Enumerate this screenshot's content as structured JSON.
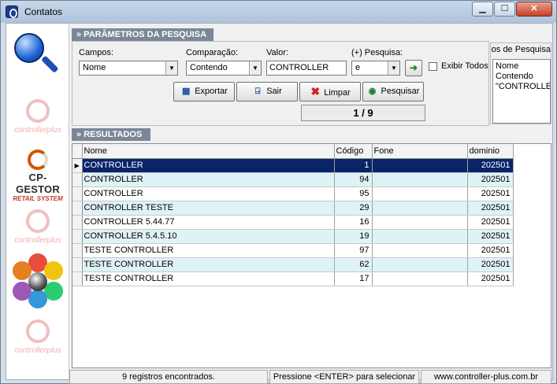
{
  "window": {
    "title": "Contatos",
    "controls": [
      "minimize",
      "maximize",
      "close"
    ]
  },
  "sidebar": {
    "logos": [
      {
        "name": "search-logo",
        "text": ""
      },
      {
        "name": "controllerplus-logo-1",
        "text": "controllerplus"
      },
      {
        "name": "cp-gestor-logo",
        "line1": "CP-GESTOR",
        "line2": "RETAIL SYSTEM"
      },
      {
        "name": "controllerplus-logo-2",
        "text": "controllerplus"
      },
      {
        "name": "flower-logo",
        "text": ""
      },
      {
        "name": "controllerplus-logo-3",
        "text": "controllerplus"
      }
    ]
  },
  "params": {
    "header": "» PARÂMETROS DA PESQUISA",
    "campos_label": "Campos:",
    "campos_value": "Nome",
    "comparacao_label": "Comparação:",
    "comparacao_value": "Contendo",
    "valor_label": "Valor:",
    "valor_value": "CONTROLLER",
    "pesquisa_label": "(+) Pesquisa:",
    "pesquisa_value": "e",
    "exibir_todos_label": "Exibir Todos",
    "exibir_todos_checked": false,
    "buttons": {
      "exportar": "Exportar",
      "sair": "Sair",
      "limpar": "Limpar",
      "pesquisar": "Pesquisar"
    },
    "page_counter": "1 / 9"
  },
  "criteria": {
    "title": "Critérios de Pesquisa",
    "items": [
      "Nome",
      "Contendo",
      "\"CONTROLLER\""
    ]
  },
  "results": {
    "header": "» RESULTADOS",
    "columns": [
      "Nome",
      "Código",
      "Fone",
      "dominio"
    ],
    "rows": [
      {
        "nome": "CONTROLLER",
        "codigo": "1",
        "fone": "",
        "dominio": "202501"
      },
      {
        "nome": "CONTROLLER",
        "codigo": "94",
        "fone": "",
        "dominio": "202501"
      },
      {
        "nome": "CONTROLLER",
        "codigo": "95",
        "fone": "",
        "dominio": "202501"
      },
      {
        "nome": "CONTROLLER TESTE",
        "codigo": "29",
        "fone": "",
        "dominio": "202501"
      },
      {
        "nome": "CONTROLLER 5.44.77",
        "codigo": "16",
        "fone": "",
        "dominio": "202501"
      },
      {
        "nome": "CONTROLLER 5.4.5.10",
        "codigo": "19",
        "fone": "",
        "dominio": "202501"
      },
      {
        "nome": "TESTE CONTROLLER",
        "codigo": "97",
        "fone": "",
        "dominio": "202501"
      },
      {
        "nome": "TESTE CONTROLLER",
        "codigo": "62",
        "fone": "",
        "dominio": "202501"
      },
      {
        "nome": "TESTE CONTROLLER",
        "codigo": "17",
        "fone": "",
        "dominio": "202501"
      }
    ],
    "selected_row": 0
  },
  "status": {
    "count": "9 registros encontrados.",
    "hint": "Pressione <ENTER> para selecionar",
    "website": "www.controller-plus.com.br"
  },
  "colors": {
    "selected_row_bg": "#0a246a",
    "alt_row_bg": "#dff3f7",
    "section_header_bg": "#7a8798",
    "limpar_icon": "#d81e1e"
  }
}
